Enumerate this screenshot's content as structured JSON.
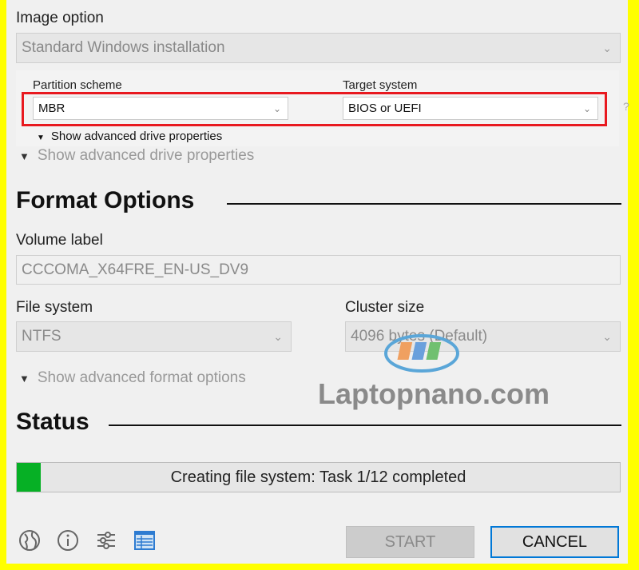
{
  "image_option": {
    "label": "Image option",
    "value": "Standard Windows installation"
  },
  "partition": {
    "label": "Partition scheme",
    "value": "MBR"
  },
  "target": {
    "label": "Target system",
    "value": "BIOS or UEFI",
    "help": "?"
  },
  "advanced_drive_inner": "Show advanced drive properties",
  "advanced_drive": "Show advanced drive properties",
  "format": {
    "title": "Format Options",
    "volume_label": "Volume label",
    "volume_value": "CCCOMA_X64FRE_EN-US_DV9",
    "fs_label": "File system",
    "fs_value": "NTFS",
    "cluster_label": "Cluster size",
    "cluster_value": "4096 bytes (Default)",
    "advanced": "Show advanced format options"
  },
  "watermark": {
    "logo": "LNN",
    "text": "Laptopnano.com"
  },
  "status": {
    "title": "Status",
    "text": "Creating file system: Task 1/12 completed",
    "progress_percent": 4,
    "progress_color": "#06b025"
  },
  "footer": {
    "icons": [
      "globe-icon",
      "info-icon",
      "settings-sliders-icon",
      "log-icon"
    ],
    "start": "START",
    "cancel": "CANCEL"
  },
  "colors": {
    "highlight": "#e8191f",
    "frame": "#ffff00"
  }
}
